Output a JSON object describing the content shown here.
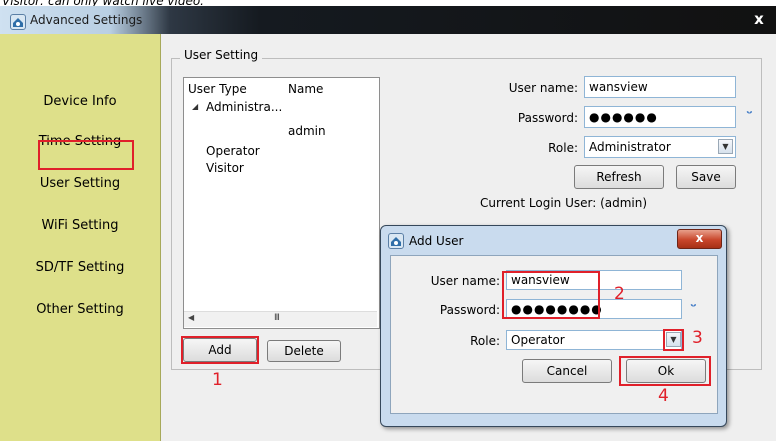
{
  "caption": "Visitor: can only watch live video.",
  "window": {
    "title": "Advanced Settings",
    "close_glyph": "x"
  },
  "sidebar": {
    "items": [
      {
        "label": "Device Info"
      },
      {
        "label": "Time Setting"
      },
      {
        "label": "User Setting"
      },
      {
        "label": "WiFi Setting"
      },
      {
        "label": "SD/TF Setting"
      },
      {
        "label": "Other Setting"
      }
    ]
  },
  "user_setting": {
    "group_label": "User Setting",
    "tree": {
      "columns": [
        "User Type",
        "Name"
      ],
      "expander_glyph": "◢",
      "rows": [
        {
          "type": "Administra...",
          "name": "admin"
        },
        {
          "type": "Operator",
          "name": ""
        },
        {
          "type": "Visitor",
          "name": ""
        }
      ],
      "scroll_thumb_glyph": "III",
      "scroll_left": "◀"
    },
    "form": {
      "username_label": "User name:",
      "username_value": "wansview",
      "password_label": "Password:",
      "password_value": "●●●●●●",
      "role_label": "Role:",
      "role_value": "Administrator",
      "refresh_label": "Refresh",
      "save_label": "Save",
      "current_login": "Current Login User: (admin)",
      "eye_glyph": "ᵕ"
    },
    "add_label": "Add",
    "delete_label": "Delete"
  },
  "dialog": {
    "title": "Add User",
    "close_glyph": "x",
    "username_label": "User name:",
    "username_value": "wansview",
    "password_label": "Password:",
    "password_value": "●●●●●●●●",
    "role_label": "Role:",
    "role_value": "Operator",
    "cancel_label": "Cancel",
    "ok_label": "Ok"
  },
  "annotations": {
    "n1": "1",
    "n2": "2",
    "n3": "3",
    "n4": "4"
  },
  "colors": {
    "sidebar": "#dee08a",
    "highlight": "#e0202a",
    "accent": "#3b77c4"
  }
}
